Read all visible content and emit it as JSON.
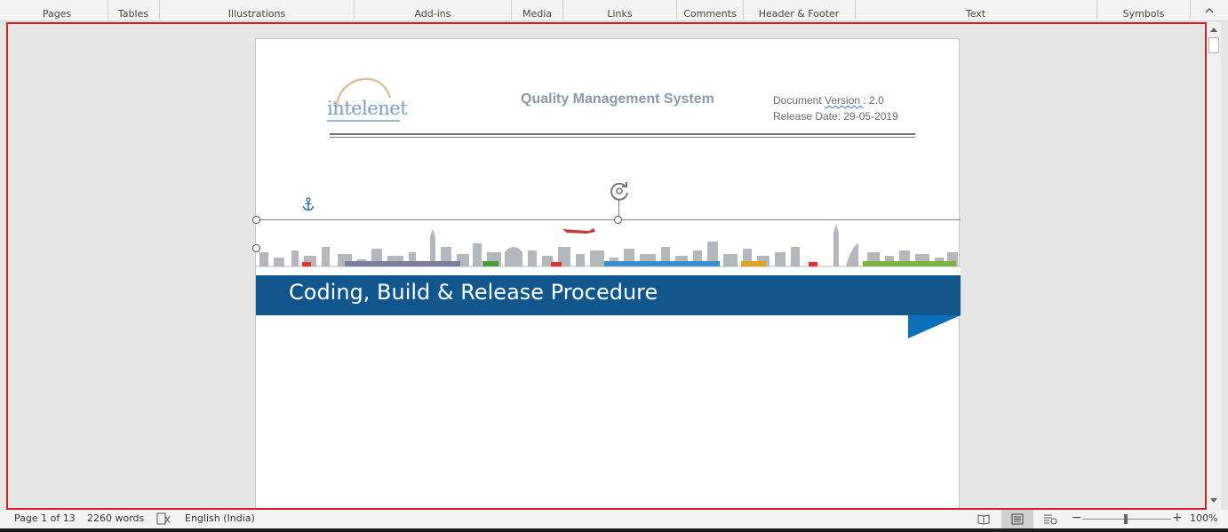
{
  "ribbon": {
    "groups": [
      "Pages",
      "Tables",
      "Illustrations",
      "Add-ins",
      "Media",
      "Links",
      "Comments",
      "Header & Footer",
      "Text",
      "Symbols"
    ],
    "collapse_icon": "chevron-up-icon"
  },
  "document": {
    "logo_text": "intelenet",
    "header_title": "Quality Management System",
    "version_label": "Document ",
    "version_word": "Version ",
    "version_value": ": 2.0",
    "release_date": "Release Date: 29-05-2019",
    "cover_title": "Coding, Build & Release Procedure",
    "colors": {
      "title_bar": "#11568c",
      "wedge": "#0b6fba",
      "logo_text": "#7a9cc1",
      "header_title": "#8a99aa",
      "selection_border": "#d62028"
    }
  },
  "status": {
    "page": "Page 1 of 13",
    "words": "2260 words",
    "proofing_icon": "proofing-icon",
    "language": "English (India)",
    "zoom_minus": "−",
    "zoom_plus": "+",
    "zoom_level": "100%"
  }
}
